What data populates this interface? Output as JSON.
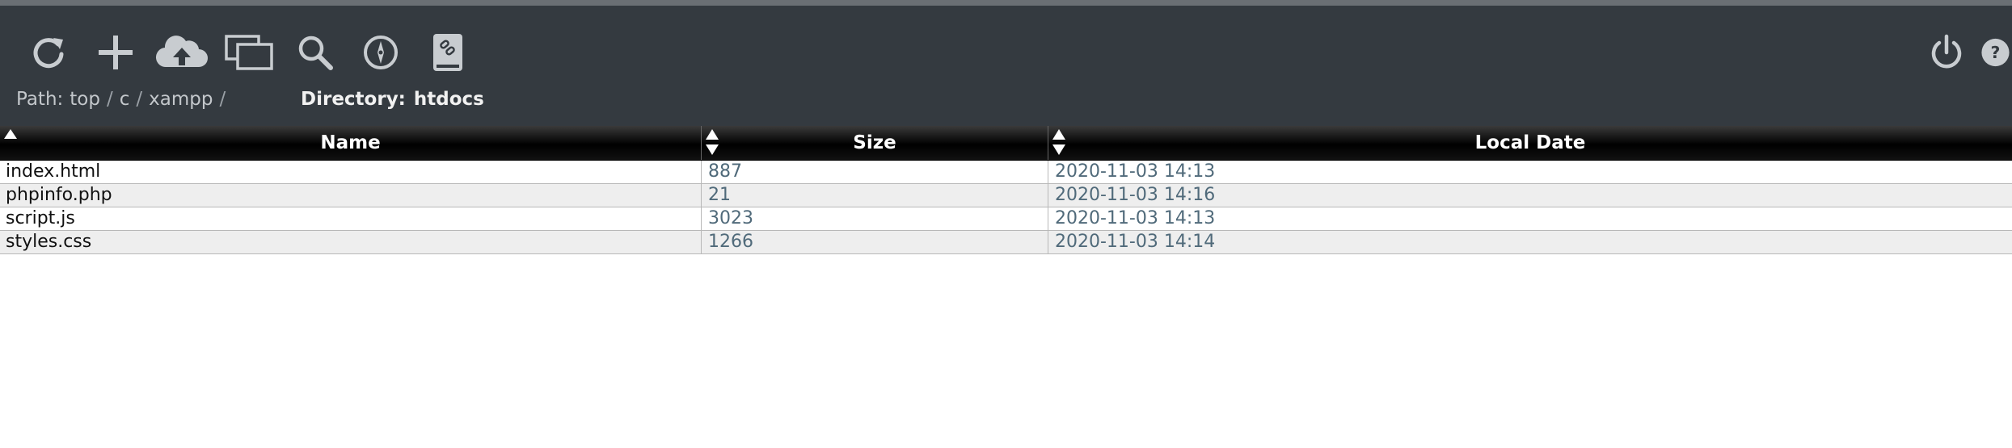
{
  "toolbar": {
    "buttons": [
      {
        "name": "refresh",
        "icon": "refresh-icon"
      },
      {
        "name": "new",
        "icon": "plus-icon"
      },
      {
        "name": "upload",
        "icon": "cloud-upload-icon"
      },
      {
        "name": "windows",
        "icon": "windows-icon"
      },
      {
        "name": "search",
        "icon": "search-icon"
      },
      {
        "name": "navigate",
        "icon": "compass-icon"
      },
      {
        "name": "link",
        "icon": "link-icon"
      },
      {
        "name": "power",
        "icon": "power-icon"
      },
      {
        "name": "help",
        "icon": "help-icon"
      }
    ],
    "icon_color": "#c8ccd0"
  },
  "path": {
    "label": "Path:",
    "segments": [
      "top",
      "c",
      "xampp"
    ],
    "separator": "/"
  },
  "directory": {
    "label": "Directory:",
    "name": "htdocs"
  },
  "table": {
    "columns": [
      "Name",
      "Size",
      "Local Date"
    ],
    "rows": [
      {
        "name": "index.html",
        "size": "887",
        "date": "2020-11-03 14:13"
      },
      {
        "name": "phpinfo.php",
        "size": "21",
        "date": "2020-11-03 14:16"
      },
      {
        "name": "script.js",
        "size": "3023",
        "date": "2020-11-03 14:13"
      },
      {
        "name": "styles.css",
        "size": "1266",
        "date": "2020-11-03 14:14"
      }
    ]
  },
  "colors": {
    "topbar": "#343a40",
    "header_bg": "#000000",
    "meta_text": "#506a7a",
    "row_alt": "#eeeeee"
  }
}
